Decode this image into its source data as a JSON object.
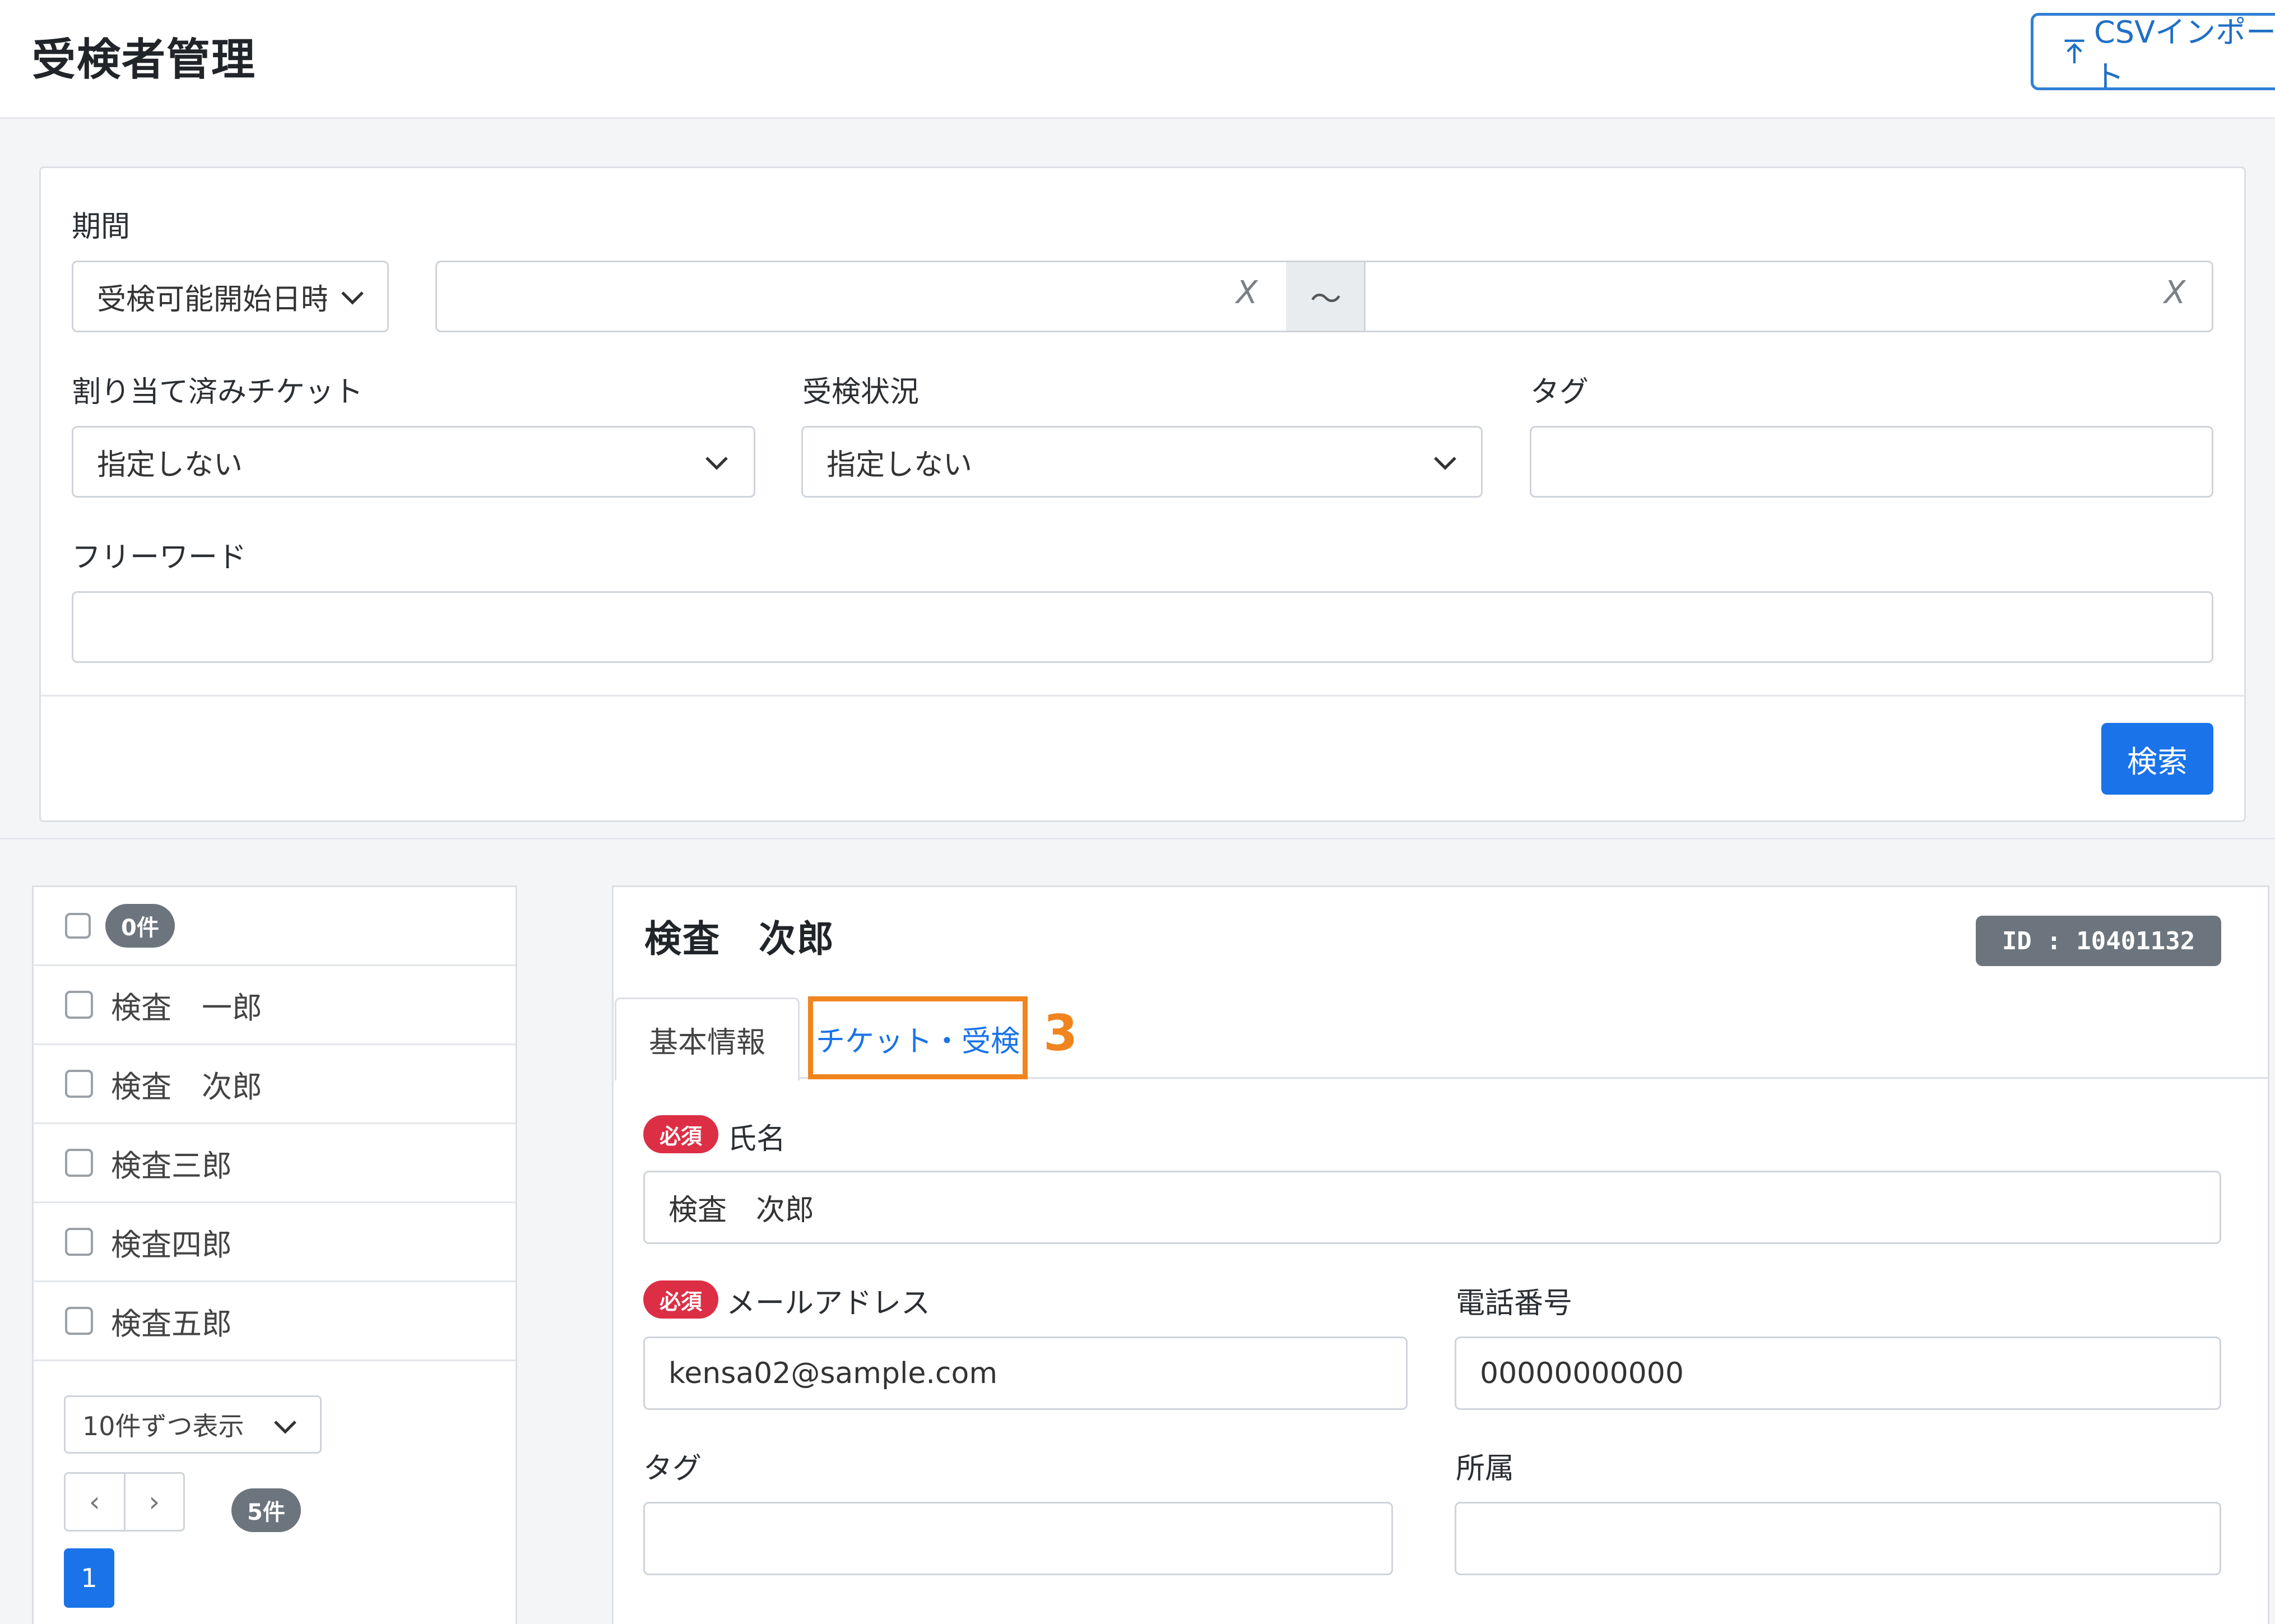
{
  "header": {
    "title": "受検者管理",
    "csv_import_label": "CSVインポート"
  },
  "search": {
    "period_label": "期間",
    "period_type_value": "受検可能開始日時",
    "date_from_value": "",
    "date_to_value": "",
    "date_separator": "〜",
    "clear_glyph": "X",
    "ticket_label": "割り当て済みチケット",
    "ticket_value": "指定しない",
    "status_label": "受検状況",
    "status_value": "指定しない",
    "tag_label": "タグ",
    "tag_value": "",
    "freeword_label": "フリーワード",
    "freeword_value": "",
    "search_button": "検索"
  },
  "list": {
    "selected_count": "0件",
    "items": [
      {
        "name": "検査　一郎"
      },
      {
        "name": "検査　次郎"
      },
      {
        "name": "検査三郎"
      },
      {
        "name": "検査四郎"
      },
      {
        "name": "検査五郎"
      }
    ],
    "per_page_value": "10件ずつ表示",
    "prev": "‹",
    "next": "›",
    "total_count": "5件",
    "current_page": "1"
  },
  "detail": {
    "name": "検査　次郎",
    "id_badge": "ID : 10401132",
    "tabs": [
      {
        "label": "基本情報"
      },
      {
        "label": "チケット・受検"
      }
    ],
    "annotation_number": "3",
    "required_badge": "必須",
    "name_label": "氏名",
    "name_value": "検査　次郎",
    "email_label": "メールアドレス",
    "email_value": "kensa02@sample.com",
    "phone_label": "電話番号",
    "phone_value": "00000000000",
    "tag_label": "タグ",
    "tag_value": "",
    "affiliation_label": "所属",
    "affiliation_value": ""
  },
  "colors": {
    "primary": "#1a73e8",
    "annotation": "#f0841e",
    "required": "#dc2f45",
    "badge_gray": "#6c757d"
  }
}
